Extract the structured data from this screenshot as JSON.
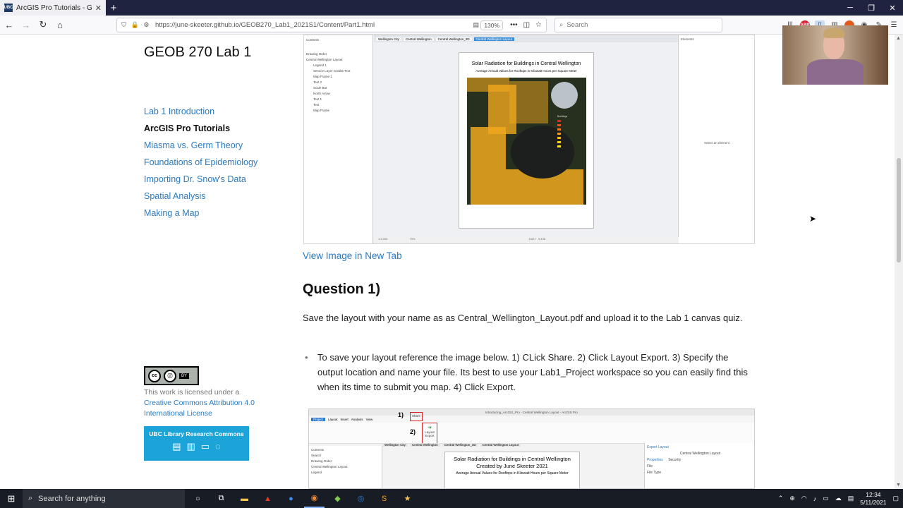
{
  "browser": {
    "tab_title": "ArcGIS Pro Tutorials - GEOB 270",
    "tab_favicon": "UBC",
    "url": "https://june-skeeter.github.io/GEOB270_Lab1_2021S1/Content/Part1.html",
    "zoom": "130%",
    "search_placeholder": "Search"
  },
  "site": {
    "title": "GEOB 270 Lab 1",
    "nav": [
      {
        "label": "Lab 1 Introduction"
      },
      {
        "label": "ArcGIS Pro Tutorials",
        "active": true
      },
      {
        "label": "Miasma vs. Germ Theory"
      },
      {
        "label": "Foundations of Epidemiology"
      },
      {
        "label": "Importing Dr. Snow's Data"
      },
      {
        "label": "Spatial Analysis"
      },
      {
        "label": "Making a Map"
      }
    ],
    "license_text": "This work is licensed under a",
    "license_link": "Creative Commons Attribution 4.0 International License",
    "cc_badge": "BY",
    "ubc_banner": "UBC Library Research Commons"
  },
  "content": {
    "view_link": "View Image in New Tab",
    "question_heading": "Question 1)",
    "question_text": "Save the layout with your name as as Central_Wellington_Layout.pdf and upload it to the Lab 1 canvas quiz.",
    "bullet_text": "To save your layout reference the image below. 1) CLick Share. 2) Click Layout Export. 3) Specify the output location and name your file. Its best to use your Lab1_Project workspace so you can easily find this when its time to submit you map. 4) Click Export."
  },
  "screenshot1": {
    "tabs": [
      "Wellington City",
      "Central Wellington",
      "Central Wellington_3D",
      "Central Wellington Layout"
    ],
    "contents_title": "Contents",
    "elements_title": "Elements",
    "contents_items": [
      "Drawing Order",
      "Central Wellington Layout",
      "Legend 1",
      "Service Layer Credits Text",
      "Map Frame 1",
      "Text 2",
      "Scale Bar",
      "North Arrow",
      "Text 1",
      "Text",
      "Map Frame"
    ],
    "layout_title": "Solar Radiation for Buildings in Central Wellington",
    "layout_subtitle": "Average Annual Values for Rooftops in Kilowatt Hours per Square Meter",
    "legend_title": "Buildings",
    "select_hint": "Select an element",
    "status_scale": "1:2,000",
    "status_zoom": "70%",
    "status_coords": "8,627 , 9,436"
  },
  "screenshot2": {
    "window_title": "Introducing_ArcGIS_Pro - Central Wellington Layout - ArcGIS Pro",
    "ribbon_tabs": [
      "Project",
      "Layout",
      "Insert",
      "Analysis",
      "View",
      "Share"
    ],
    "step1": "1)",
    "step2": "2)",
    "share_label": "Share",
    "export_label": "Layout",
    "export_sub": "Export",
    "tabs": [
      "Wellington City",
      "Central Wellington",
      "Central Wellington_3D",
      "Central Wellington Layout"
    ],
    "contents_items": [
      "Contents",
      "Search",
      "Drawing Order",
      "Central Wellington Layout",
      "Legend"
    ],
    "layout_title": "Solar Radiation for Buildings in Central Wellington",
    "layout_subtitle": "Created by June Skeeter 2021",
    "layout_sub2": "Average Annual Values for Rooftops in Kilowatt Hours per Square Meter",
    "export_pane_title": "Export Layout",
    "export_pane_sub": "Central Wellington Layout",
    "export_pane_tabs": [
      "Properties",
      "Security"
    ],
    "export_file": "File",
    "export_filetype": "File Type"
  },
  "taskbar": {
    "search_text": "Search for anything",
    "time": "12:34",
    "date": "5/11/2021"
  },
  "colors": {
    "link": "#2a7ac0",
    "taskbar": "#181c24",
    "tabstrip": "#202340",
    "ubc_banner": "#1ca3d8",
    "highlight_box": "#d32626"
  }
}
